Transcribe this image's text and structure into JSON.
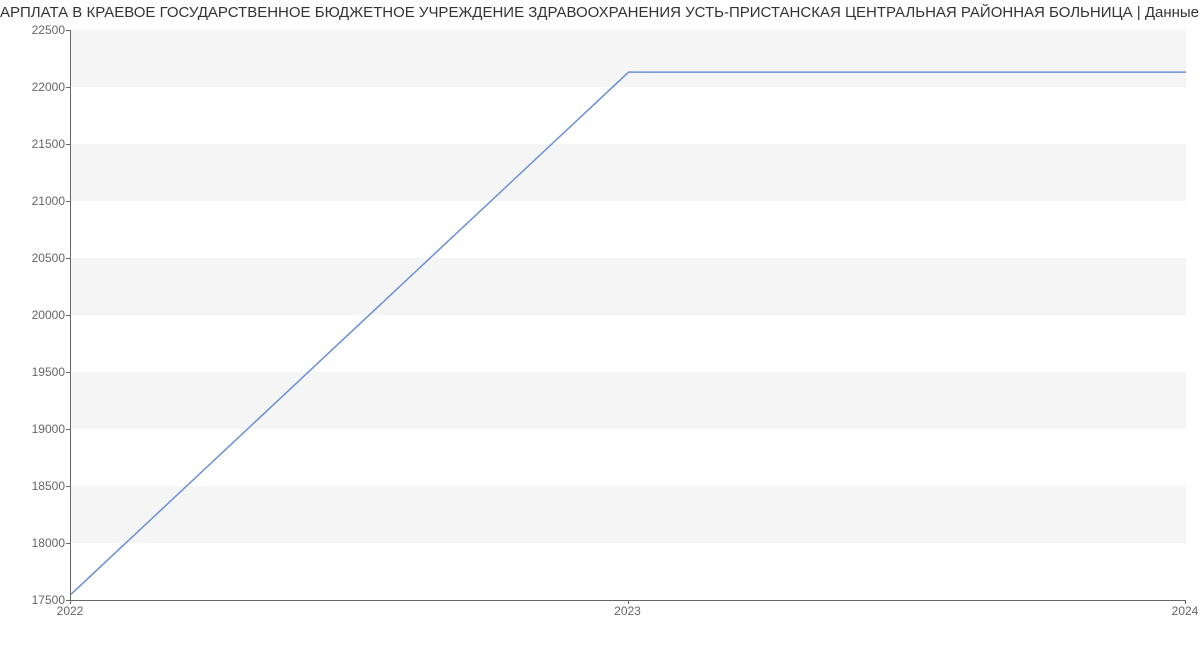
{
  "chart_data": {
    "type": "line",
    "title": "АРПЛАТА В КРАЕВОЕ ГОСУДАРСТВЕННОЕ БЮДЖЕТНОЕ УЧРЕЖДЕНИЕ ЗДРАВООХРАНЕНИЯ УСТЬ-ПРИСТАНСКАЯ ЦЕНТРАЛЬНАЯ РАЙОННАЯ БОЛЬНИЦА | Данные mnogo.wor",
    "x": [
      2022,
      2023,
      2024
    ],
    "x_labels": [
      "2022",
      "2023",
      "2024"
    ],
    "values": [
      17550,
      22130,
      22130
    ],
    "ylim": [
      17500,
      22500
    ],
    "y_ticks": [
      17500,
      18000,
      18500,
      19000,
      19500,
      20000,
      20500,
      21000,
      21500,
      22000,
      22500
    ],
    "xlabel": "",
    "ylabel": "",
    "line_color": "#6b8fd4",
    "band_color": "#f5f5f5"
  }
}
